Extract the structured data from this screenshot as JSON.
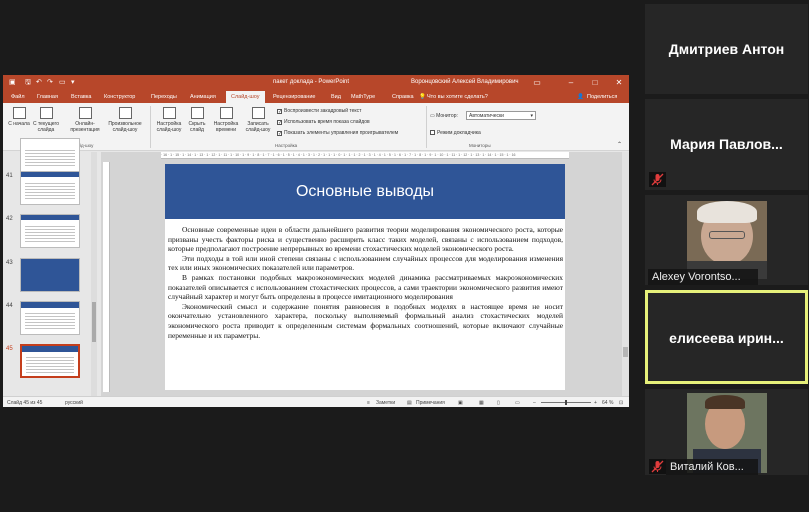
{
  "app": {
    "title": "пакет доклада - PowerPoint",
    "user": "Воронцовский Алексей Владимирович",
    "search_hint": "Что вы хотите сделать?",
    "share_label": "Поделиться",
    "win_min": "–",
    "win_max": "□",
    "win_close": "✕"
  },
  "tabs": [
    "Файл",
    "Главная",
    "Вставка",
    "Конструктор",
    "Переходы",
    "Анимация",
    "Слайд-шоу",
    "Рецензирование",
    "Вид",
    "MathType",
    "Справка"
  ],
  "active_tab": "Слайд-шоу",
  "ribbon": {
    "from_start": "С начала",
    "from_current": "С текущего слайда",
    "online": "Онлайн-презентация",
    "custom": "Произвольное слайд-шоу",
    "group_start": "Начать слайд-шоу",
    "setup": "Настройка слайд-шоу",
    "hide": "Скрыть слайд",
    "timings": "Настройка времени",
    "record": "Записать слайд-шоу",
    "play_narrations": "Воспроизвести закадровый текст",
    "use_timings": "Использовать время показа слайдов",
    "show_controls": "Показать элементы управления проигрывателем",
    "group_setup": "Настройка",
    "monitor_label": "Монитор:",
    "monitor_value": "Автоматически",
    "presenter_view": "Режим докладчика",
    "group_monitors": "Мониторы"
  },
  "thumbs": [
    {
      "num": "41"
    },
    {
      "num": "42"
    },
    {
      "num": "43"
    },
    {
      "num": "44"
    },
    {
      "num": "45"
    }
  ],
  "selected_slide": "45",
  "slide": {
    "title": "Основные выводы",
    "paragraphs": [
      "Основные современные идеи в области дальнейшего развития теории моделирования экономического роста, которые призваны учесть факторы риска и существенно расширить класс таких моделей, связаны с использованием подходов, которые предполагают построение непрерывных во времени стохастических моделей экономического роста.",
      "Эти подходы в той или иной степени связаны с использованием случайных процессов для моделирования изменения тех или иных экономических показателей или параметров.",
      "В рамках постановки подобных макроэкономических моделей динамика рассматриваемых макроэкономических показателей описывается с использованием стохастических процессов, а сами траектории экономического развития имеют случайный характер и могут быть определены в процессе имитационного моделирования",
      "Экономический смысл и содержание понятия равновесия в подобных моделях в настоящее время не носит окончательно установленного характера, поскольку выполняемый формальный анализ стохастических моделей экономического роста приводит к определенным системам формальных соотношений, которые включают случайные переменные и их параметры."
    ]
  },
  "statusbar": {
    "slide_info": "Слайд 45 из 45",
    "language": "русский",
    "notes": "Заметки",
    "comments": "Примечания",
    "zoom": "64 %"
  },
  "participants": [
    {
      "name": "Дмитриев Антон",
      "type": "name",
      "muted": false
    },
    {
      "name": "Мария Павлов...",
      "type": "name",
      "muted": true
    },
    {
      "name": "Alexey Vorontso...",
      "type": "video",
      "muted": false
    },
    {
      "name": "елисеева ирин...",
      "type": "name",
      "muted": false,
      "active": true
    },
    {
      "name": "Виталий Ков...",
      "type": "video",
      "muted": true
    }
  ],
  "colors": {
    "ppt_red": "#b7472a",
    "slide_blue": "#2f5597",
    "speaker_highlight": "#e6f07a",
    "mute_red": "#e03c3c"
  }
}
